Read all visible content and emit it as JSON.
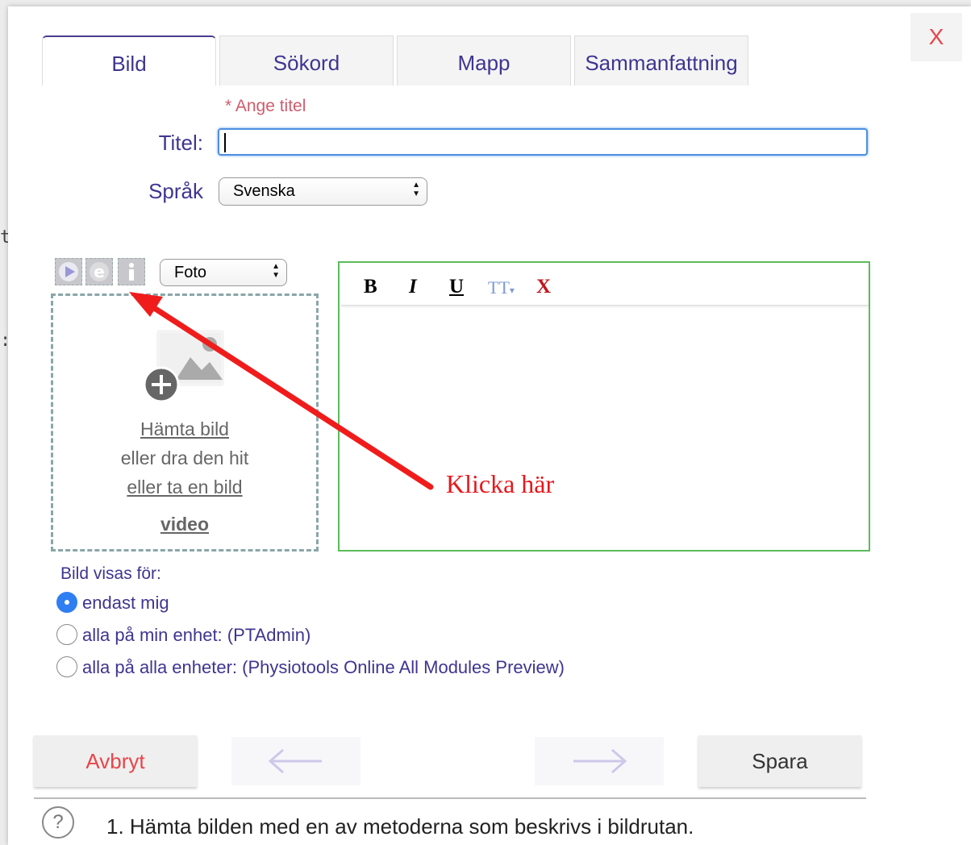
{
  "background": {
    "fragment_1": "t",
    "fragment_2": ":"
  },
  "dialog": {
    "close_label": "X"
  },
  "tabs": [
    {
      "label": "Bild",
      "active": true
    },
    {
      "label": "Sökord",
      "active": false
    },
    {
      "label": "Mapp",
      "active": false
    },
    {
      "label": "Sammanfattning",
      "active": false
    }
  ],
  "form": {
    "title_required": "* Ange titel",
    "title_label": "Titel:",
    "title_value": "",
    "language_label": "Språk",
    "language_value": "Svenska"
  },
  "media": {
    "icons": [
      "play-icon",
      "e-icon",
      "info-icon"
    ],
    "type_value": "Foto",
    "fetch_link": "Hämta bild",
    "drag_text": "eller dra den hit",
    "take_link": "eller ta en bild",
    "video_link": "video"
  },
  "editor": {
    "buttons": {
      "bold": "B",
      "italic": "I",
      "underline": "U",
      "font_size": "TT",
      "clear": "X"
    },
    "content": ""
  },
  "visibility": {
    "label": "Bild visas för:",
    "options": [
      {
        "label": "endast mig",
        "checked": true
      },
      {
        "label": "alla på min enhet: (PTAdmin)",
        "checked": false
      },
      {
        "label": "alla på alla enheter: (Physiotools Online All Modules Preview)",
        "checked": false
      }
    ]
  },
  "buttons": {
    "cancel": "Avbryt",
    "save": "Spara",
    "prev": "←",
    "next": "→"
  },
  "help": {
    "icon": "?",
    "text": "1. Hämta bilden med en av metoderna som beskrivs i bildrutan."
  },
  "annotation": {
    "text": "Klicka här"
  },
  "colors": {
    "brand_text": "#3e3590",
    "required": "#d05c6c",
    "close": "#e8454a",
    "editor_border": "#5cbb5c",
    "focus": "#4d8fe0",
    "annotation": "#e8161b",
    "radio_checked": "#2f7ef2"
  }
}
